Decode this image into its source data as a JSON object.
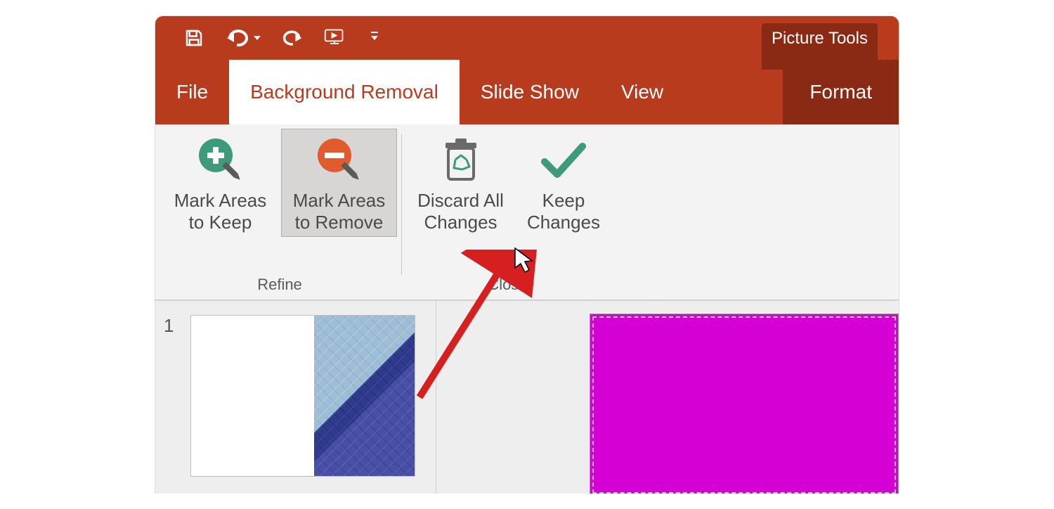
{
  "titlebar": {
    "context_tab": "Picture Tools"
  },
  "tabs": {
    "file": "File",
    "background_removal": "Background Removal",
    "slide_show": "Slide Show",
    "view": "View",
    "format": "Format"
  },
  "ribbon": {
    "refine": {
      "group_label": "Refine",
      "mark_keep": "Mark Areas to Keep",
      "mark_remove": "Mark Areas to Remove"
    },
    "close": {
      "group_label": "Close",
      "discard": "Discard All Changes",
      "keep": "Keep Changes"
    }
  },
  "slides": {
    "items": [
      {
        "index": "1"
      }
    ]
  },
  "colors": {
    "accent": "#b83b1e",
    "accent_dark": "#8a2a14",
    "plus_icon": "#3d9a7b",
    "minus_icon": "#e25b2f",
    "check_icon": "#3d9a7b",
    "selection_magenta": "#d400d4"
  }
}
